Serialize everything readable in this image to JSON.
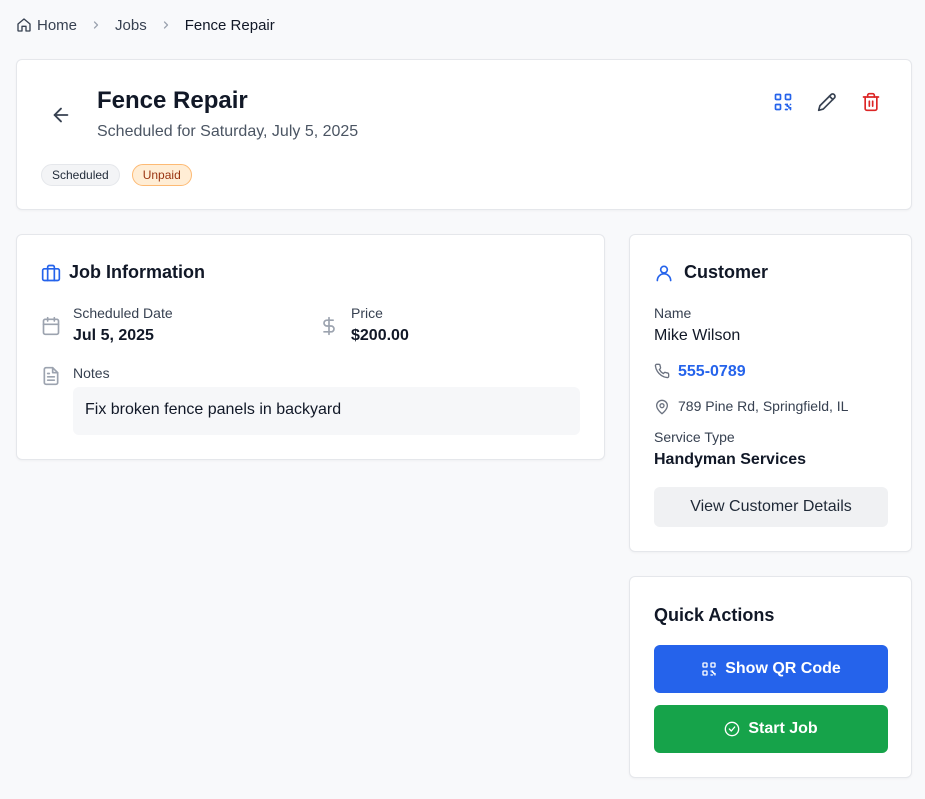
{
  "breadcrumb": {
    "home": "Home",
    "jobs": "Jobs",
    "current": "Fence Repair"
  },
  "job": {
    "title": "Fence Repair",
    "subtitle": "Scheduled for Saturday, July 5, 2025",
    "status_badge": "Scheduled",
    "payment_badge": "Unpaid"
  },
  "job_info": {
    "heading": "Job Information",
    "scheduled_date_label": "Scheduled Date",
    "scheduled_date_value": "Jul 5, 2025",
    "price_label": "Price",
    "price_value": "$200.00",
    "notes_label": "Notes",
    "notes_value": "Fix broken fence panels in backyard"
  },
  "customer": {
    "heading": "Customer",
    "name_label": "Name",
    "name_value": "Mike Wilson",
    "phone": "555-0789",
    "address": "789 Pine Rd, Springfield, IL",
    "service_type_label": "Service Type",
    "service_type_value": "Handyman Services",
    "view_details_button": "View Customer Details"
  },
  "quick_actions": {
    "heading": "Quick Actions",
    "qr_button": "Show QR Code",
    "start_button": "Start Job"
  },
  "icons": {
    "home": "home-icon",
    "back": "arrow-left-icon",
    "qr": "qr-code-icon",
    "edit": "pencil-icon",
    "delete": "trash-icon",
    "briefcase": "briefcase-icon",
    "calendar": "calendar-icon",
    "dollar": "dollar-icon",
    "notes": "file-text-icon",
    "user": "user-icon",
    "phone": "phone-icon",
    "location": "map-pin-icon",
    "check": "check-circle-icon"
  },
  "colors": {
    "primary": "#2563eb",
    "success": "#16a34a",
    "danger": "#dc2626",
    "unpaid_badge_bg": "#ffedd5",
    "unpaid_badge_text": "#9a3412"
  }
}
